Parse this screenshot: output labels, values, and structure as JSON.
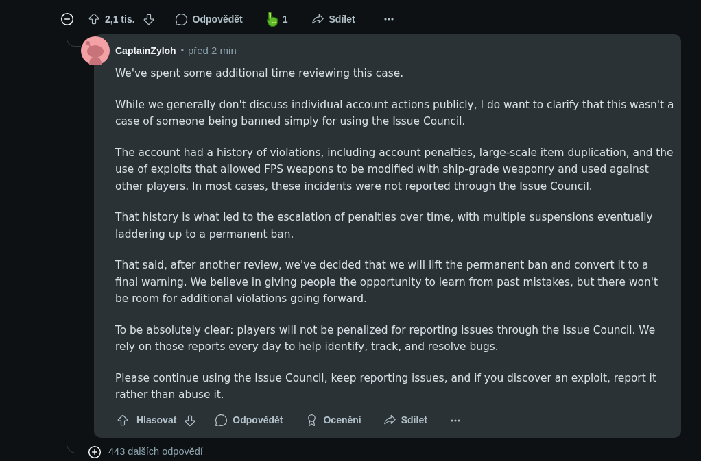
{
  "parent_thread": {
    "expanded": true,
    "vote_count": "2,1 tis.",
    "reply_label": "Odpovědět",
    "award_count": "1",
    "share_label": "Sdílet"
  },
  "reply": {
    "author": "CaptainZyloh",
    "separator": "•",
    "time": "před 2 min",
    "paragraphs": [
      "We've spent some additional time reviewing this case.",
      "While we generally don't discuss individual account actions publicly, I do want to clarify that this wasn't a case of someone being banned simply for using the Issue Council.",
      "The account had a history of violations, including account penalties, large-scale item duplication, and the use of exploits that allowed FPS weapons to be modified with ship-grade weaponry and used against other players. In most cases, these incidents were not reported through the Issue Council.",
      "That history is what led to the escalation of penalties over time, with multiple suspensions eventually laddering up to a permanent ban.",
      "That said, after another review, we've decided that we will lift the permanent ban and convert it to a final warning. We believe in giving people the opportunity to learn from past mistakes, but there won't be room for additional violations going forward.",
      "To be absolutely clear: players will not be penalized for reporting issues through the Issue Council. We rely on those reports every day to help identify, track, and resolve bugs.",
      "Please continue using the Issue Council, keep reporting issues, and if you discover an exploit, report it rather than abuse it."
    ],
    "actions": {
      "vote_label": "Hlasovat",
      "reply_label": "Odpovědět",
      "award_label": "Ocenění",
      "share_label": "Sdílet"
    }
  },
  "more_replies": {
    "label": "443 dalších odpovědí"
  }
}
